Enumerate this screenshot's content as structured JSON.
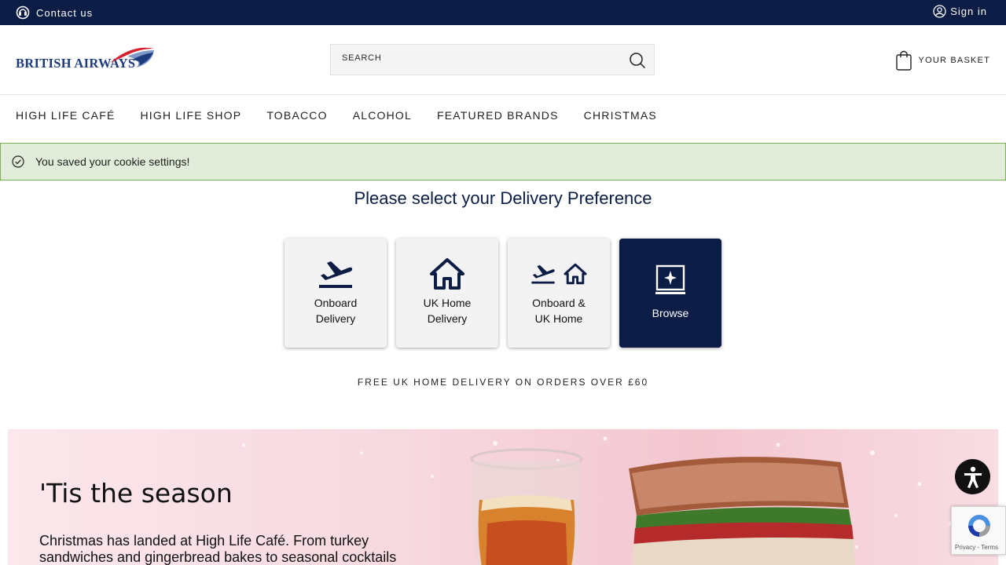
{
  "topbar": {
    "contact_label": "Contact us",
    "signin_label": "Sign in",
    "background": "#0b1c45"
  },
  "header": {
    "logo_text": "BRITISH AIRWAYS",
    "search_placeholder": "SEARCH",
    "basket_label": "YOUR BASKET"
  },
  "nav": {
    "items": [
      "HIGH LIFE CAFÉ",
      "HIGH LIFE SHOP",
      "TOBACCO",
      "ALCOHOL",
      "FEATURED BRANDS",
      "CHRISTMAS"
    ]
  },
  "notice": {
    "message": "You saved your cookie settings!",
    "icon": "check-circle-icon"
  },
  "delivery": {
    "title": "Please select your Delivery Preference",
    "options": [
      {
        "label": "Onboard Delivery",
        "icon": "plane-takeoff-icon"
      },
      {
        "label": "UK Home Delivery",
        "icon": "home-icon"
      },
      {
        "label": "Onboard & UK Home",
        "icon": "plane-and-home-icon"
      },
      {
        "label": "Browse",
        "icon": "browse-laptop-icon",
        "selected": true
      }
    ],
    "free_delivery_text": "FREE UK HOME DELIVERY ON ORDERS OVER £60"
  },
  "banner": {
    "heading": "'Tis the season",
    "body": "Christmas has landed at High Life Café. From turkey sandwiches and gingerbread bakes to seasonal cocktails"
  },
  "widgets": {
    "recaptcha_text": "Privacy - Terms"
  },
  "colors": {
    "navy": "#0b1c45",
    "notice_bg": "#e2ecda",
    "notice_border": "#7bb254"
  }
}
